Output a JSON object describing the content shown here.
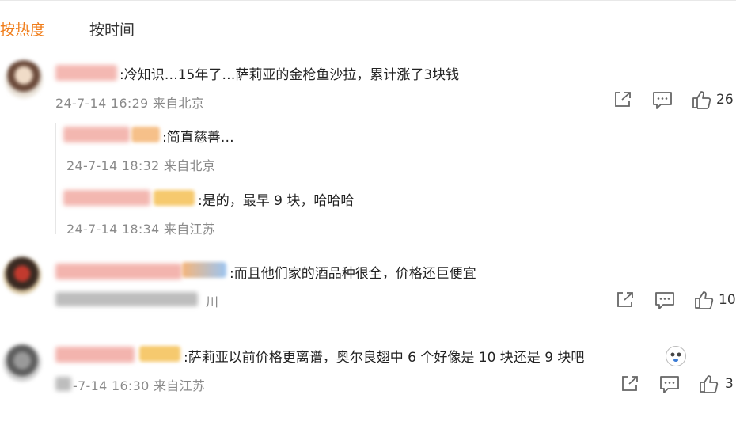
{
  "tabs": {
    "hot": "按热度",
    "time": "按时间"
  },
  "comments": [
    {
      "text": ":冷知识…15年了…萨莉亚的金枪鱼沙拉，累计涨了3块钱",
      "meta": "24-7-14 16:29 来自北京",
      "likes": "26"
    },
    {
      "text": ":而且他们家的酒品种很全，价格还巨便宜",
      "meta_visible": "川",
      "likes": "10"
    },
    {
      "text": ":萨莉亚以前价格更离谱，奥尔良翅中 6 个好像是 10 块还是 9 块吧",
      "meta": "-7-14 16:30 来自江苏",
      "likes": "3"
    }
  ],
  "replies": [
    {
      "text": ":简直慈善…",
      "meta": "24-7-14 18:32 来自北京"
    },
    {
      "text": ":是的，最早 9 块，哈哈哈",
      "meta": "24-7-14 18:34 来自江苏"
    }
  ],
  "colors": {
    "accent": "#f07d1a",
    "text": "#222222",
    "meta": "#8a8a8a",
    "icon": "#666666"
  },
  "icons": [
    "share-icon",
    "comment-icon",
    "like-icon",
    "emoji-icon"
  ]
}
